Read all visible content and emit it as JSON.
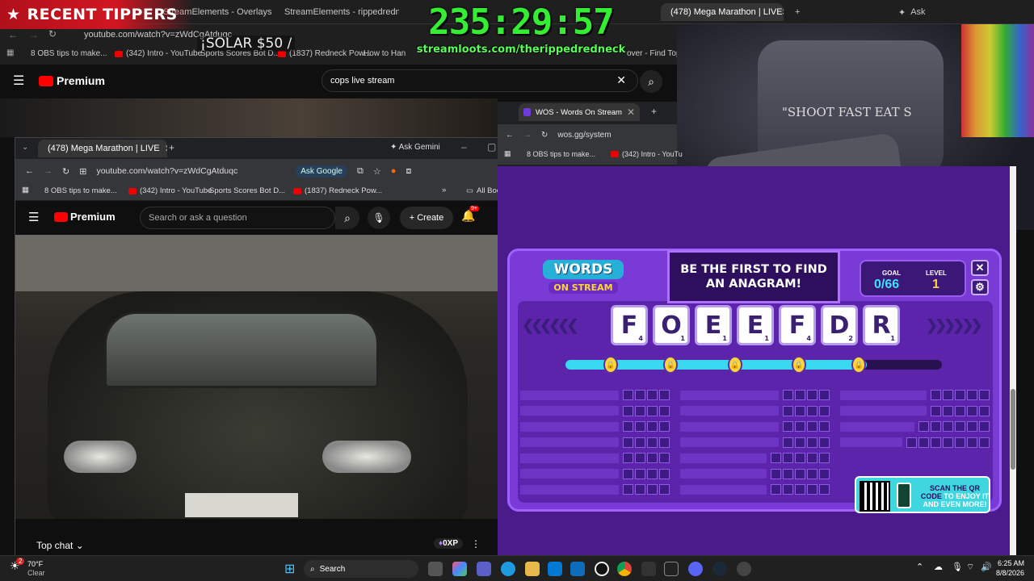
{
  "back_browser": {
    "tabs": [
      {
        "label": "StreamElements - Overlays"
      },
      {
        "label": "StreamElements - rippedredne"
      },
      {
        "label": "(478) Mega Marathon | LIVESTR"
      }
    ],
    "url": "youtube.com/watch?v=zWdCgAtduqc",
    "bookmarks": [
      "8 OBS tips to make...",
      "(342) Intro - YouTube",
      "Sports Scores Bot D...",
      "(1837) Redneck Pow...",
      "How to Han",
      "over - Find Top..."
    ],
    "ask_gemini": "Ask",
    "youtube_brand": "Premium",
    "search_value": "cops live stream"
  },
  "overlay": {
    "recent_tippers": "RECENT TIPPERS",
    "solar": "¡SOLAR $50 /",
    "timer": "235:29:57",
    "streamloots": "streamloots.com/therippedredneck",
    "shirt_text": "\"SHOOT FAST EAT S"
  },
  "yt_window": {
    "tab_label": "(478) Mega Marathon | LIVE",
    "ask_gemini": "Ask Gemini",
    "url": "youtube.com/watch?v=zWdCgAtduqc",
    "ask_google": "Ask Google",
    "bookmarks": [
      "8 OBS tips to make...",
      "(342) Intro - YouTube",
      "Sports Scores Bot D...",
      "(1837) Redneck Pow..."
    ],
    "all_bookmarks": "All Boo",
    "brand": "Premium",
    "search_placeholder": "Search or ask a question",
    "create": "Create",
    "notif_badge": "9+",
    "top_chat": "Top chat",
    "xp": "0XP",
    "video_icon_color": "#ff0000"
  },
  "wos_window": {
    "tab_label": "WOS - Words On Stream",
    "url": "wos.gg/system",
    "bookmarks": [
      "8 OBS tips to make...",
      "(342) Intro - YouTu"
    ]
  },
  "wos_game": {
    "logo_words": "WORDS",
    "logo_stream": "ON STREAM",
    "prompt": "BE THE FIRST TO FIND AN ANAGRAM!",
    "goal_label": "GOAL",
    "goal_value": "0/66",
    "level_label": "LEVEL",
    "level_value": "1",
    "close": "✕",
    "settings": "⚙",
    "letters": [
      {
        "char": "F",
        "pts": "4"
      },
      {
        "char": "O",
        "pts": "1"
      },
      {
        "char": "E",
        "pts": "1"
      },
      {
        "char": "E",
        "pts": "1"
      },
      {
        "char": "F",
        "pts": "4"
      },
      {
        "char": "D",
        "pts": "2"
      },
      {
        "char": "R",
        "pts": "1"
      }
    ],
    "progress_fraction": 0.8,
    "qr_line1": "SCAN THE QR",
    "qr_line2": "CODE",
    "qr_line2b": "TO ENJOY IT",
    "qr_line3": "AND EVEN MORE!",
    "accent": "#7a3ad6",
    "tile_color": "#ffffff"
  },
  "taskbar": {
    "weather_temp": "70°F",
    "weather_desc": "Clear",
    "weather_badge": "2",
    "search_label": "Search",
    "time": "6:25 AM",
    "date": "8/8/2026"
  }
}
